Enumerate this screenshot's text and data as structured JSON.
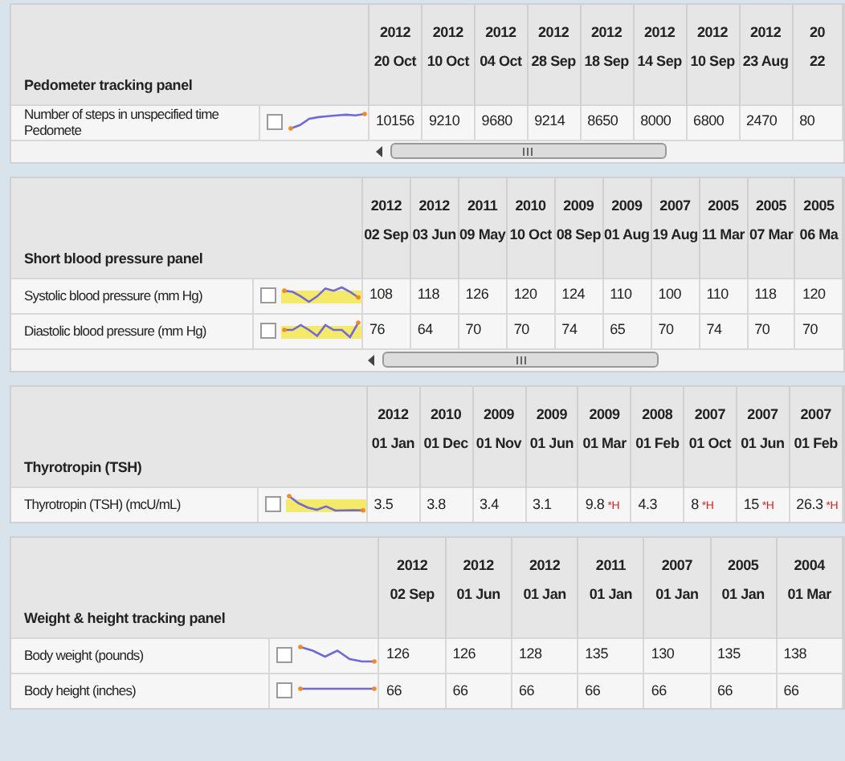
{
  "panels": [
    {
      "title": "Pedometer tracking panel",
      "scrollbar": true,
      "dates": [
        {
          "year": "2012",
          "day": "20 Oct"
        },
        {
          "year": "2012",
          "day": "10 Oct"
        },
        {
          "year": "2012",
          "day": "04 Oct"
        },
        {
          "year": "2012",
          "day": "28 Sep"
        },
        {
          "year": "2012",
          "day": "18 Sep"
        },
        {
          "year": "2012",
          "day": "14 Sep"
        },
        {
          "year": "2012",
          "day": "10 Sep"
        },
        {
          "year": "2012",
          "day": "23 Aug"
        },
        {
          "year": "20",
          "day": "22"
        }
      ],
      "rows": [
        {
          "label": "Number of steps in unspecified time Pedomete",
          "checked": false,
          "reference_band": false,
          "values": [
            {
              "value": "10156"
            },
            {
              "value": "9210"
            },
            {
              "value": "9680"
            },
            {
              "value": "9214"
            },
            {
              "value": "8650"
            },
            {
              "value": "8000"
            },
            {
              "value": "6800"
            },
            {
              "value": "2470"
            },
            {
              "value": "80"
            }
          ]
        }
      ]
    },
    {
      "title": "Short blood pressure panel",
      "scrollbar": true,
      "dates": [
        {
          "year": "2012",
          "day": "02 Sep"
        },
        {
          "year": "2012",
          "day": "03 Jun"
        },
        {
          "year": "2011",
          "day": "09 May"
        },
        {
          "year": "2010",
          "day": "10 Oct"
        },
        {
          "year": "2009",
          "day": "08 Sep"
        },
        {
          "year": "2009",
          "day": "01 Aug"
        },
        {
          "year": "2007",
          "day": "19 Aug"
        },
        {
          "year": "2005",
          "day": "11 Mar"
        },
        {
          "year": "2005",
          "day": "07 Mar"
        },
        {
          "year": "2005",
          "day": "06 Ma"
        }
      ],
      "rows": [
        {
          "label": "Systolic blood pressure (mm Hg)",
          "checked": false,
          "reference_band": true,
          "values": [
            {
              "value": "108"
            },
            {
              "value": "118"
            },
            {
              "value": "126"
            },
            {
              "value": "120"
            },
            {
              "value": "124"
            },
            {
              "value": "110"
            },
            {
              "value": "100"
            },
            {
              "value": "110"
            },
            {
              "value": "118"
            },
            {
              "value": "120"
            }
          ]
        },
        {
          "label": "Diastolic blood pressure (mm Hg)",
          "checked": false,
          "reference_band": true,
          "values": [
            {
              "value": "76"
            },
            {
              "value": "64"
            },
            {
              "value": "70"
            },
            {
              "value": "70"
            },
            {
              "value": "74"
            },
            {
              "value": "65"
            },
            {
              "value": "70"
            },
            {
              "value": "74"
            },
            {
              "value": "70"
            },
            {
              "value": "70"
            }
          ]
        }
      ]
    },
    {
      "title": "Thyrotropin (TSH)",
      "scrollbar": false,
      "dates": [
        {
          "year": "2012",
          "day": "01 Jan"
        },
        {
          "year": "2010",
          "day": "01 Dec"
        },
        {
          "year": "2009",
          "day": "01 Nov"
        },
        {
          "year": "2009",
          "day": "01 Jun"
        },
        {
          "year": "2009",
          "day": "01 Mar"
        },
        {
          "year": "2008",
          "day": "01 Feb"
        },
        {
          "year": "2007",
          "day": "01 Oct"
        },
        {
          "year": "2007",
          "day": "01 Jun"
        },
        {
          "year": "2007",
          "day": "01 Feb"
        }
      ],
      "rows": [
        {
          "label": "Thyrotropin (TSH) (mcU/mL)",
          "checked": false,
          "reference_band": true,
          "values": [
            {
              "value": "3.5"
            },
            {
              "value": "3.8"
            },
            {
              "value": "3.4"
            },
            {
              "value": "3.1"
            },
            {
              "value": "9.8",
              "flag": "*H"
            },
            {
              "value": "4.3"
            },
            {
              "value": "8",
              "flag": "*H"
            },
            {
              "value": "15",
              "flag": "*H"
            },
            {
              "value": "26.3",
              "flag": "*H"
            }
          ]
        }
      ]
    },
    {
      "title": "Weight & height tracking panel",
      "scrollbar": false,
      "dates": [
        {
          "year": "2012",
          "day": "02 Sep"
        },
        {
          "year": "2012",
          "day": "01 Jun"
        },
        {
          "year": "2012",
          "day": "01 Jan"
        },
        {
          "year": "2011",
          "day": "01 Jan"
        },
        {
          "year": "2007",
          "day": "01 Jan"
        },
        {
          "year": "2005",
          "day": "01 Jan"
        },
        {
          "year": "2004",
          "day": "01 Mar"
        }
      ],
      "rows": [
        {
          "label": "Body weight (pounds)",
          "checked": false,
          "reference_band": false,
          "values": [
            {
              "value": "126"
            },
            {
              "value": "126"
            },
            {
              "value": "128"
            },
            {
              "value": "135"
            },
            {
              "value": "130"
            },
            {
              "value": "135"
            },
            {
              "value": "138"
            }
          ]
        },
        {
          "label": "Body height (inches)",
          "checked": false,
          "reference_band": false,
          "values": [
            {
              "value": "66"
            },
            {
              "value": "66"
            },
            {
              "value": "66"
            },
            {
              "value": "66"
            },
            {
              "value": "66"
            },
            {
              "value": "66"
            },
            {
              "value": "66"
            }
          ]
        }
      ]
    }
  ]
}
